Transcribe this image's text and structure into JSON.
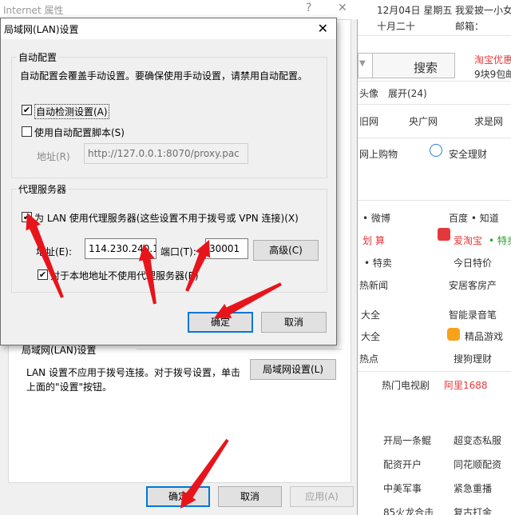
{
  "background": {
    "items": [
      {
        "text": "12月04日 星期五",
        "color": "#333333"
      },
      {
        "text": "我爱披一小女",
        "color": "#333333"
      },
      {
        "text": "十月二十",
        "color": "#333333"
      },
      {
        "text": "邮箱：",
        "color": "#333333"
      },
      {
        "text": "搜索",
        "color": "#333333"
      },
      {
        "text": "淘宝优惠",
        "color": "#e4393c"
      },
      {
        "text": "9块9包邮",
        "color": "#333333"
      },
      {
        "text": "头像",
        "color": "#333333"
      },
      {
        "text": "展开(24)",
        "color": "#333333"
      },
      {
        "text": "旧网",
        "color": "#333333"
      },
      {
        "text": "央广网",
        "color": "#333333"
      },
      {
        "text": "求是网",
        "color": "#333333"
      },
      {
        "text": "网上购物",
        "color": "#333333"
      },
      {
        "text": "安全理财",
        "color": "#333333"
      },
      {
        "text": "• 微博",
        "color": "#333333"
      },
      {
        "text": "百度 • 知道",
        "color": "#333333"
      },
      {
        "text": "划 算",
        "color": "#e4393c"
      },
      {
        "text": "爱淘宝",
        "color": "#e4393c"
      },
      {
        "text": "• 特卖",
        "color": "#2a9d2a"
      },
      {
        "text": "• 特卖",
        "color": "#333333"
      },
      {
        "text": "今日特价",
        "color": "#333333"
      },
      {
        "text": "热新闻",
        "color": "#333333"
      },
      {
        "text": "安居客房产",
        "color": "#333333"
      },
      {
        "text": "大全",
        "color": "#333333"
      },
      {
        "text": "智能录音笔",
        "color": "#333333"
      },
      {
        "text": "大全",
        "color": "#333333"
      },
      {
        "text": "精品游戏",
        "color": "#333333"
      },
      {
        "text": "热点",
        "color": "#333333"
      },
      {
        "text": "搜狗理财",
        "color": "#333333"
      },
      {
        "text": "热门电视剧",
        "color": "#333333"
      },
      {
        "text": "阿里1688",
        "color": "#e4393c"
      },
      {
        "text": "开局一条鲲",
        "color": "#333333"
      },
      {
        "text": "超变态私服",
        "color": "#333333"
      },
      {
        "text": "配资开户",
        "color": "#333333"
      },
      {
        "text": "同花顺配资",
        "color": "#333333"
      },
      {
        "text": "中美军事",
        "color": "#333333"
      },
      {
        "text": "紧急重播",
        "color": "#333333"
      },
      {
        "text": "85火龙合击",
        "color": "#333333"
      },
      {
        "text": "复古打金",
        "color": "#333333"
      }
    ]
  },
  "internet_properties": {
    "title": "Internet 属性",
    "help_glyph": "?",
    "close_glyph": "✕",
    "lan_section_label": "局域网(LAN)设置",
    "lan_info_text_1": "LAN 设置不应用于拨号连接。对于拨号设置，单击",
    "lan_info_text_2": "上面的\"设置\"按钮。",
    "lan_settings_button": "局域网设置(L)",
    "ok_button": "确定",
    "cancel_button": "取消",
    "apply_button": "应用(A)"
  },
  "lan_dialog": {
    "title": "局域网(LAN)设置",
    "close_glyph": "✕",
    "auto_config": {
      "group_label": "自动配置",
      "description": "自动配置会覆盖手动设置。要确保使用手动设置，请禁用自动配置。",
      "auto_detect_label": "自动检测设置(A)",
      "auto_detect_checked": true,
      "use_script_label": "使用自动配置脚本(S)",
      "use_script_checked": false,
      "address_label": "地址(R)",
      "address_value": "http://127.0.0.1:8070/proxy.pac"
    },
    "proxy": {
      "group_label": "代理服务器",
      "use_proxy_label": "为 LAN 使用代理服务器(这些设置不用于拨号或 VPN 连接)(X)",
      "use_proxy_checked": true,
      "address_label": "地址(E):",
      "address_value": "114.230.240.11",
      "port_label": "端口(T):",
      "port_value": "30001",
      "advanced_button": "高级(C)",
      "bypass_label": "对于本地地址不使用代理服务器(B)",
      "bypass_checked": true
    },
    "ok_button": "确定",
    "cancel_button": "取消"
  },
  "colors": {
    "annotation_arrow": "#e8141b",
    "focus_border": "#0078d7"
  }
}
